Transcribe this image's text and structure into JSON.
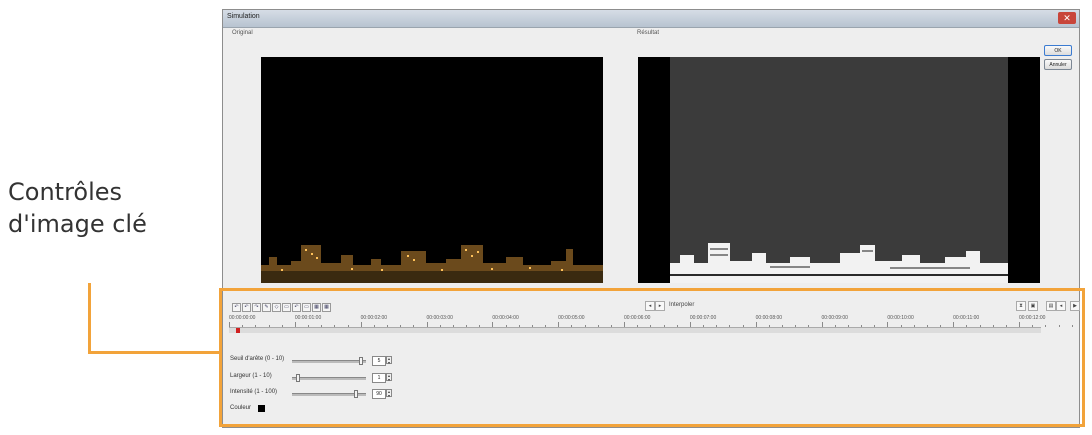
{
  "callout": {
    "line1": "Contrôles",
    "line2": "d'image clé",
    "color": "#f2a33a"
  },
  "window": {
    "title": "Simulation",
    "close_glyph": "✕"
  },
  "panes": {
    "original_label": "Original",
    "result_label": "Résultat"
  },
  "buttons": {
    "ok": "OK",
    "cancel": "Annuler"
  },
  "toolbar": {
    "tools": [
      "↶",
      "↶",
      "↷",
      "✎",
      "◇",
      "▭",
      "↶",
      "▭",
      "▦",
      "▦"
    ],
    "mode_label": "Interpoler",
    "nav": [
      "◂",
      "▸",
      "⧗",
      "▣",
      "▤",
      "◂",
      "▶"
    ]
  },
  "timeline": {
    "labels": [
      "00:00:00:00",
      "00:00:01:00",
      "00:00:02:00",
      "00:00:03:00",
      "00:00:04:00",
      "00:00:05:00",
      "00:00:06:00",
      "00:00:07:00",
      "00:00:08:00",
      "00:00:09:00",
      "00:00:10:00",
      "00:00:11:00",
      "00:00:12:00"
    ]
  },
  "params": [
    {
      "label": "Seuil d'arête (0 - 10)",
      "value": "5",
      "level": 0.95
    },
    {
      "label": "Largeur (1 - 10)",
      "value": "1",
      "level": 0.05
    },
    {
      "label": "Intensité (1 - 100)",
      "value": "90",
      "level": 0.88
    },
    {
      "label": "Couleur",
      "swatch": "#000000"
    }
  ]
}
